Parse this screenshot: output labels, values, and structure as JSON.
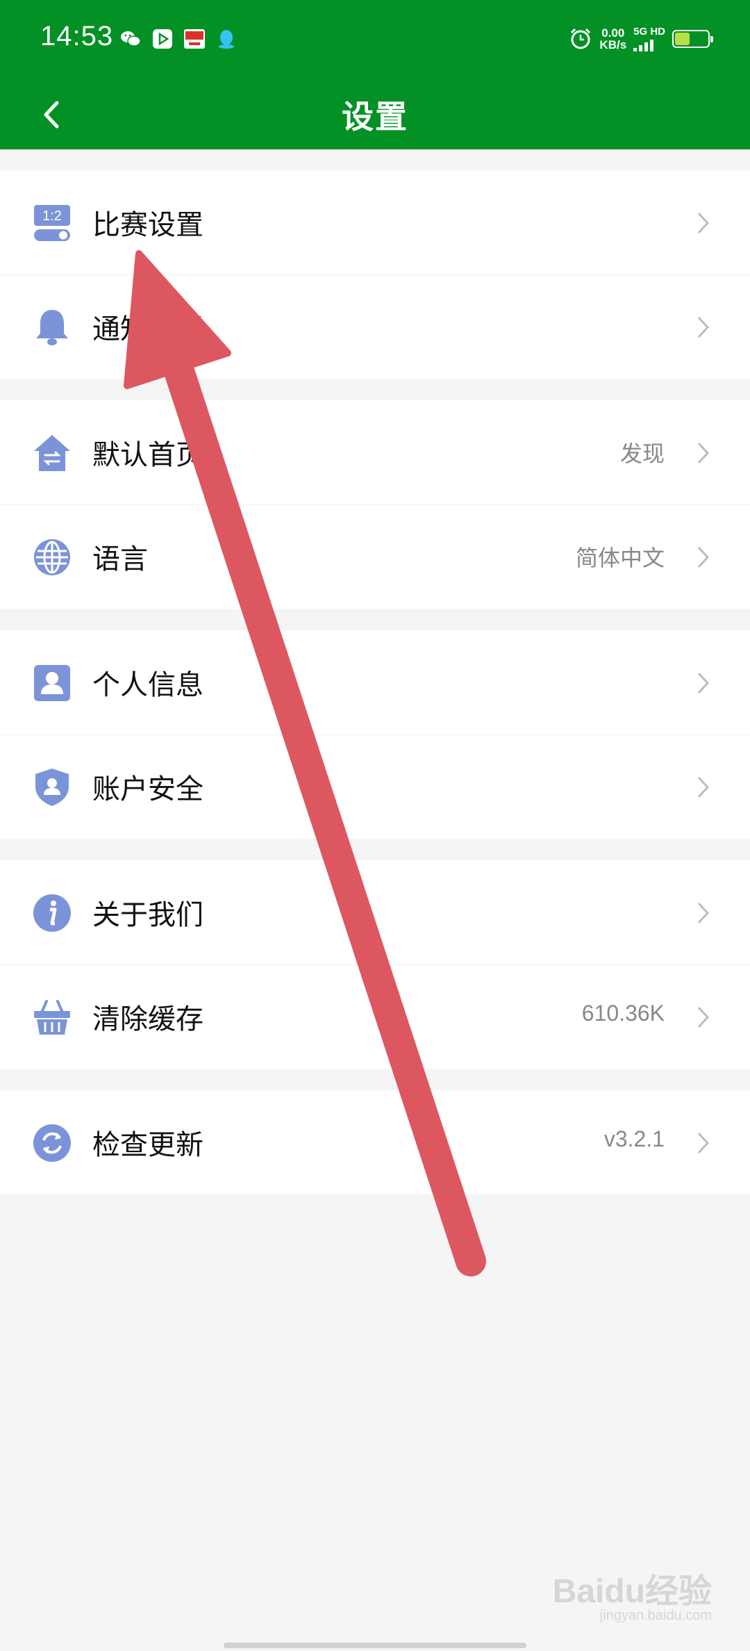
{
  "status_bar": {
    "time": "14:53",
    "net_speed_value": "0.00",
    "net_speed_unit": "KB/s",
    "network_label": "5G HD",
    "battery_level": 0.45,
    "notification_icons": [
      "wechat-icon",
      "video-app-icon",
      "news-app-icon",
      "qq-icon"
    ]
  },
  "header": {
    "title": "设置",
    "background_color": "#039126"
  },
  "settings": {
    "group1": [
      {
        "label": "比赛设置",
        "icon": "match-settings-icon",
        "value": ""
      },
      {
        "label": "通知设置",
        "icon": "bell-icon",
        "value": ""
      }
    ],
    "group2": [
      {
        "label": "默认首页",
        "icon": "home-switch-icon",
        "value": "发现"
      },
      {
        "label": "语言",
        "icon": "globe-icon",
        "value": "简体中文"
      }
    ],
    "group3": [
      {
        "label": "个人信息",
        "icon": "profile-icon",
        "value": ""
      },
      {
        "label": "账户安全",
        "icon": "shield-icon",
        "value": ""
      }
    ],
    "group4": [
      {
        "label": "关于我们",
        "icon": "info-icon",
        "value": ""
      },
      {
        "label": "清除缓存",
        "icon": "basket-icon",
        "value": "610.36K"
      }
    ],
    "group5": [
      {
        "label": "检查更新",
        "icon": "refresh-icon",
        "value": "v3.2.1"
      }
    ]
  },
  "icon_color": "#7b93d8",
  "annotation_color": "#dd5760",
  "watermark": {
    "line1": "Baidu经验",
    "line2": "jingyan.baidu.com"
  }
}
